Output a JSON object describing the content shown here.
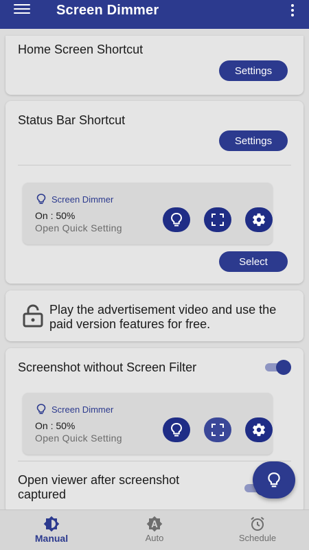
{
  "colors": {
    "primary": "#2c3a8e",
    "background": "#dcdcdc",
    "card": "#e5e5e5"
  },
  "appbar": {
    "title": "Screen Dimmer",
    "menu_icon": "hamburger-icon",
    "overflow_icon": "more-vert-icon"
  },
  "home_shortcut": {
    "title": "Home Screen Shortcut",
    "button": "Settings"
  },
  "status_shortcut": {
    "title": "Status Bar Shortcut",
    "button": "Settings",
    "tile": {
      "app_name": "Screen Dimmer",
      "status": "On : 50%",
      "subtitle": "Open Quick Setting"
    },
    "select_button": "Select"
  },
  "ad": {
    "text": "Play the advertisement video and use the paid version features for free.",
    "icon": "lock-icon"
  },
  "screenshot": {
    "title": "Screenshot without Screen Filter",
    "toggle_on": true,
    "tile": {
      "app_name": "Screen Dimmer",
      "status": "On : 50%",
      "subtitle": "Open Quick Setting"
    }
  },
  "viewer": {
    "title": "Open viewer after screenshot captured",
    "toggle_on": true
  },
  "bottom_nav": {
    "items": [
      {
        "label": "Manual",
        "icon": "brightness-icon",
        "active": true
      },
      {
        "label": "Auto",
        "icon": "auto-brightness-icon",
        "active": false
      },
      {
        "label": "Schedule",
        "icon": "alarm-icon",
        "active": false
      }
    ]
  }
}
